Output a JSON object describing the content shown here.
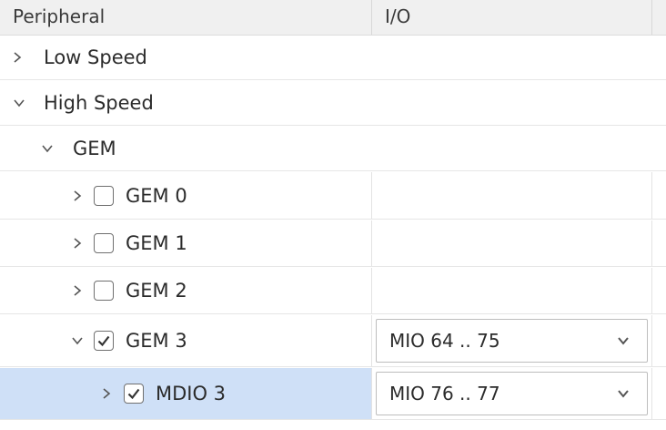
{
  "header": {
    "col_peripheral": "Peripheral",
    "col_io": "I/O"
  },
  "rows": {
    "low_speed": {
      "label": "Low Speed"
    },
    "high_speed": {
      "label": "High Speed"
    },
    "gem": {
      "label": "GEM"
    },
    "gem0": {
      "label": "GEM 0",
      "checked": false
    },
    "gem1": {
      "label": "GEM 1",
      "checked": false
    },
    "gem2": {
      "label": "GEM 2",
      "checked": false
    },
    "gem3": {
      "label": "GEM 3",
      "checked": true,
      "io": "MIO 64 .. 75"
    },
    "mdio3": {
      "label": "MDIO 3",
      "checked": true,
      "io": "MIO 76 .. 77",
      "selected": true
    }
  },
  "colors": {
    "selection": "#cfe0f7",
    "header_bg": "#f0f0f0"
  },
  "icons": {
    "collapsed": "chevron-right-icon",
    "expanded": "chevron-down-icon",
    "combo": "chevron-down-icon"
  }
}
